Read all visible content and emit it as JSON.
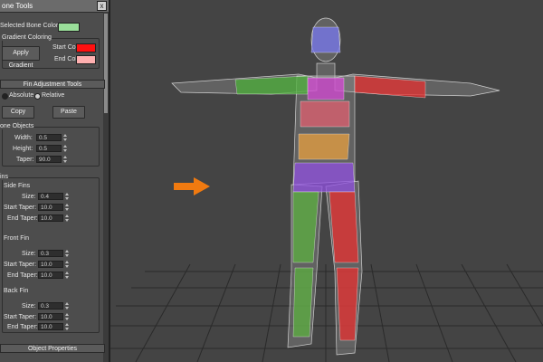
{
  "panel": {
    "title": "one Tools",
    "close_glyph": "x",
    "selected_bone_color_label": "Selected Bone Color",
    "selected_bone_color": "#9adf9a",
    "gradient": {
      "header": "Gradient Coloring",
      "apply_label": "Apply Gradient",
      "start_label": "Start Color:",
      "start_color": "#ff1010",
      "end_label": "End Color:",
      "end_color": "#ffb0b0"
    },
    "fin_tools": {
      "header": "Fin Adjustment Tools",
      "absolute_label": "Absolute",
      "relative_label": "Relative",
      "copy_label": "Copy",
      "paste_label": "Paste"
    },
    "bone_objects": {
      "header": "one Objects",
      "width_label": "Width:",
      "width_value": "0.5",
      "height_label": "Height:",
      "height_value": "0.5",
      "taper_label": "Taper:",
      "taper_value": "90.0"
    },
    "fins": {
      "header": "ins",
      "side": {
        "label": "Side Fins",
        "size_label": "Size:",
        "size_value": "0.4",
        "start_label": "Start Taper:",
        "start_value": "10.0",
        "end_label": "End Taper:",
        "end_value": "10.0"
      },
      "front": {
        "label": "Front Fin",
        "size_label": "Size:",
        "size_value": "0.3",
        "start_label": "Start Taper:",
        "start_value": "10.0",
        "end_label": "End Taper:",
        "end_value": "10.0"
      },
      "back": {
        "label": "Back Fin",
        "size_label": "Size:",
        "size_value": "0.3",
        "start_label": "Start Taper:",
        "start_value": "10.0",
        "end_label": "End Taper:",
        "end_value": "10.0"
      }
    },
    "object_properties_label": "Object Properties"
  },
  "viewport": {
    "arrow_color": "#f07a10",
    "bone_colors": {
      "head": "#7878f0",
      "chest": "#d64ad6",
      "ribs": "#e06070",
      "belly": "#e8a040",
      "pelvis": "#9050e0",
      "left_arm": "#4caf3a",
      "right_arm": "#e63030",
      "left_leg": "#5cb040",
      "right_leg": "#e83030"
    }
  }
}
